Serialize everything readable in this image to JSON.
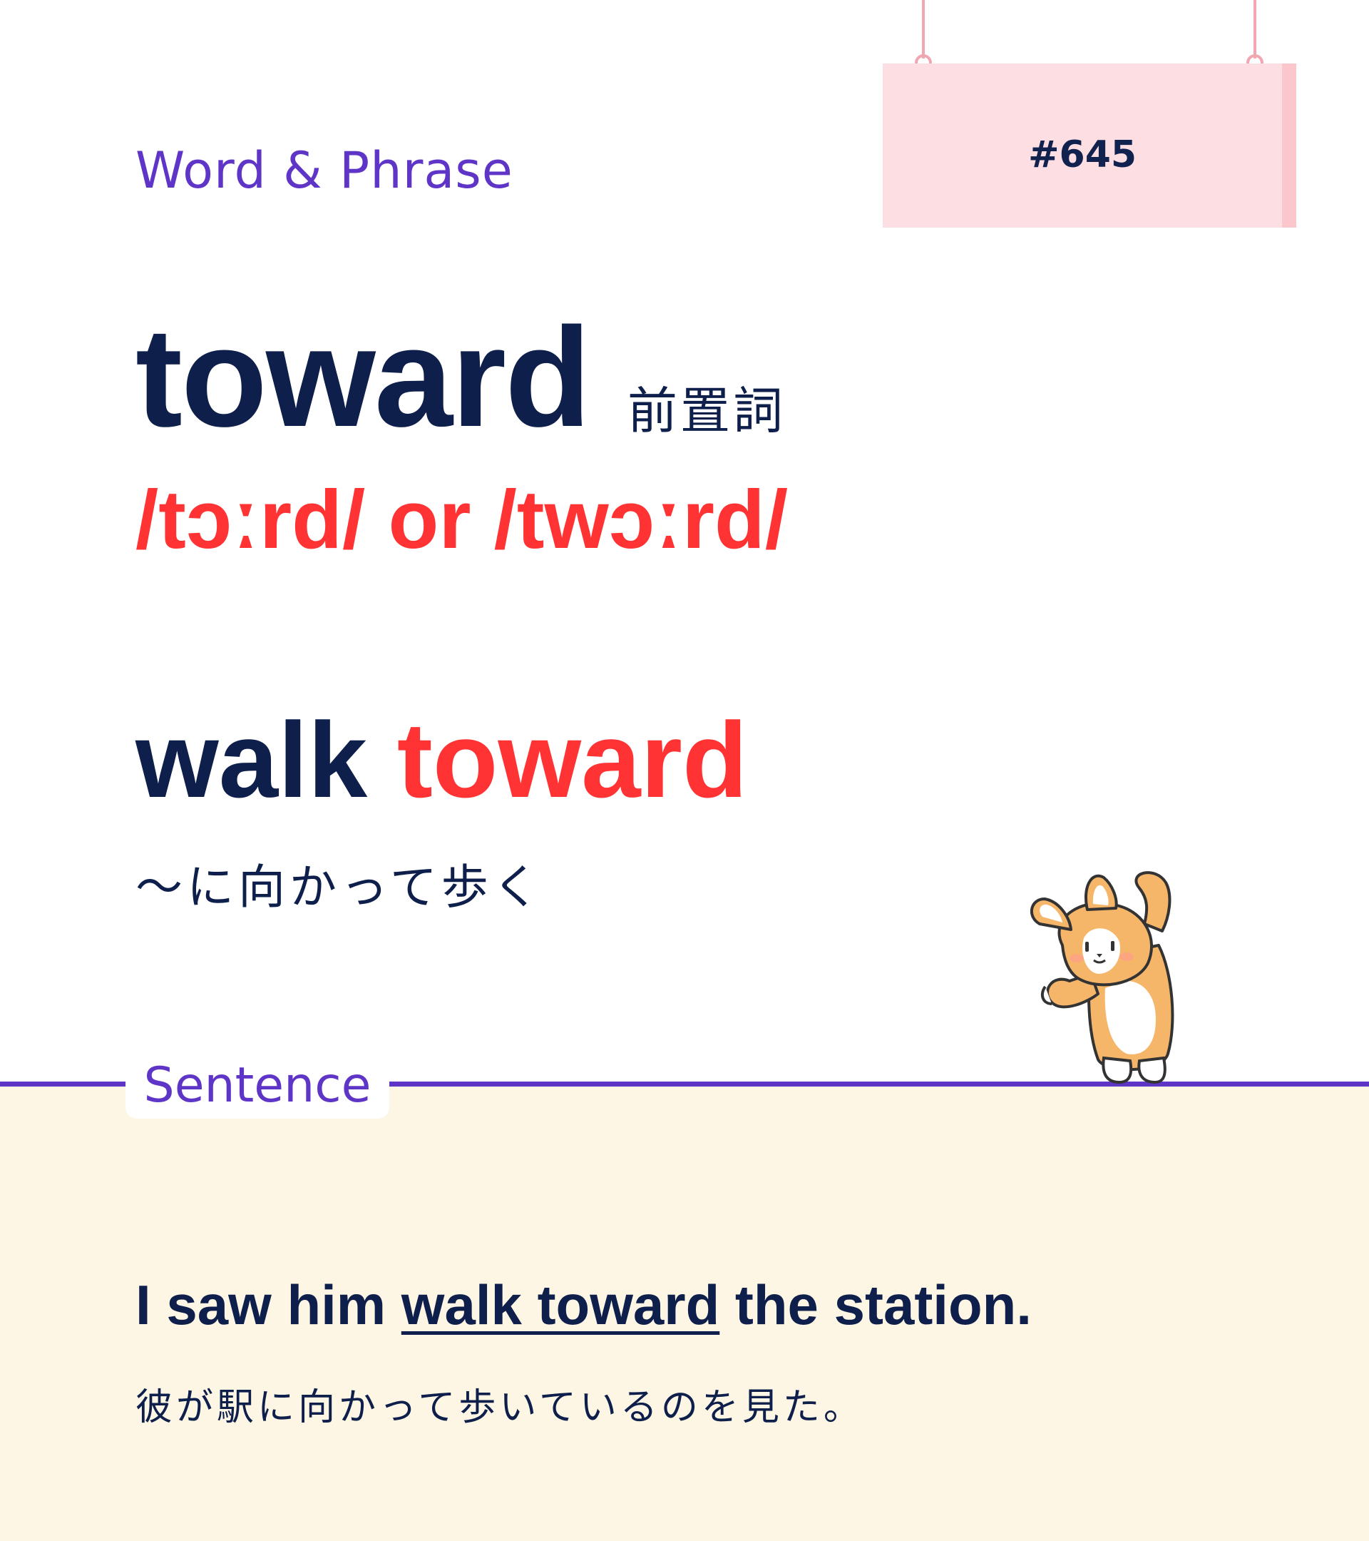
{
  "header": {
    "section_label": "Word & Phrase",
    "number": "#645"
  },
  "entry": {
    "word": "toward",
    "part_of_speech": "前置詞",
    "pronunciation": "/tɔːrd/ or /twɔːrd/"
  },
  "phrase": {
    "prefix": "walk ",
    "keyword": "toward",
    "meaning_ja": "～に向かって歩く"
  },
  "sentence_section": {
    "label": "Sentence",
    "before": "I saw him ",
    "highlight": "walk toward",
    "after": " the station.",
    "translation_ja": "彼が駅に向かって歩いているのを見た。"
  },
  "colors": {
    "accent_purple": "#5e35c7",
    "accent_red": "#ff3333",
    "text_navy": "#0d1f4a",
    "sign_pink": "#fddfe3",
    "bottom_cream": "#fdf6e4"
  },
  "illustration": "corgi-waving-icon"
}
